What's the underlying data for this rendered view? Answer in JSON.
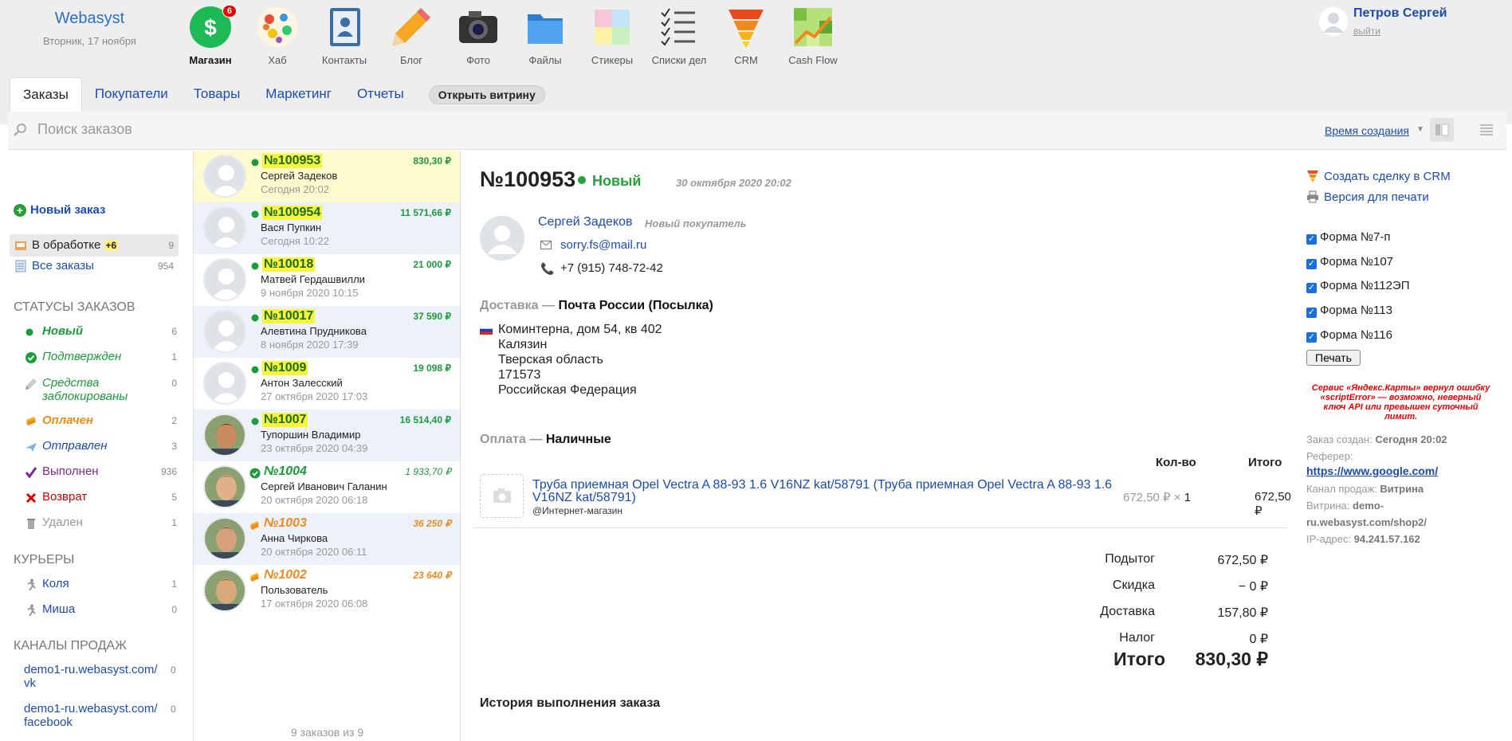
{
  "brand": {
    "name": "Webasyst",
    "date": "Вторник, 17 ноября"
  },
  "apps": [
    {
      "label": "Магазин",
      "icon": "dollar-icon",
      "badge": "6",
      "color": "#1db954"
    },
    {
      "label": "Хаб",
      "icon": "hub-icon",
      "color": "#f0a"
    },
    {
      "label": "Контакты",
      "icon": "contacts-book-icon",
      "color": "#3a6ea5"
    },
    {
      "label": "Блог",
      "icon": "pencil-icon",
      "color": "#f5a623"
    },
    {
      "label": "Фото",
      "icon": "camera-icon",
      "color": "#333"
    },
    {
      "label": "Файлы",
      "icon": "folder-icon",
      "color": "#3b8fd9"
    },
    {
      "label": "Стикеры",
      "icon": "stickers-icon",
      "color": "#f7c6d9"
    },
    {
      "label": "Списки дел",
      "icon": "checklist-icon",
      "color": "#555"
    },
    {
      "label": "CRM",
      "icon": "funnel-icon",
      "color": "#f08a1c"
    },
    {
      "label": "Cash Flow",
      "icon": "cashflow-icon",
      "color": "#7bc043"
    }
  ],
  "user": {
    "name": "Петров Сергей",
    "logout": "выйти"
  },
  "tabs": [
    "Заказы",
    "Покупатели",
    "Товары",
    "Маркетинг",
    "Отчеты"
  ],
  "store_button": "Открыть витрину",
  "search": {
    "placeholder": "Поиск заказов",
    "sort": "Время создания"
  },
  "sidebar": {
    "new_order": "Новый заказ",
    "processing": {
      "label": "В обработке",
      "plus": "+6",
      "count": "9"
    },
    "all": {
      "label": "Все заказы",
      "count": "954"
    },
    "statuses_title": "Статусы заказов",
    "statuses": [
      {
        "label": "Новый",
        "count": "6",
        "color": "#1a9c3a",
        "icon": "green-dot-icon"
      },
      {
        "label": "Подтвержден",
        "count": "1",
        "color": "#1a9c3a",
        "icon": "check-circle-icon"
      },
      {
        "label": "Средства заблокированы",
        "count": "0",
        "color": "#1a9c3a",
        "icon": "pencil-lock-icon"
      },
      {
        "label": "Оплачен",
        "count": "2",
        "color": "#f08a1c",
        "icon": "money-icon"
      },
      {
        "label": "Отправлен",
        "count": "3",
        "color": "#1a4bb5",
        "icon": "plane-icon"
      },
      {
        "label": "Выполнен",
        "count": "936",
        "color": "#7a2a8a",
        "icon": "checkmark-icon"
      },
      {
        "label": "Возврат",
        "count": "5",
        "color": "#d00",
        "icon": "cross-icon"
      },
      {
        "label": "Удален",
        "count": "1",
        "color": "#999",
        "icon": "trash-icon"
      }
    ],
    "couriers_title": "Курьеры",
    "couriers": [
      {
        "label": "Коля",
        "count": "1"
      },
      {
        "label": "Миша",
        "count": "0"
      }
    ],
    "channels_title": "Каналы продаж",
    "channels": [
      {
        "label1": "demo1-ru.webasyst.com/",
        "label2": "vk",
        "count": "0"
      },
      {
        "label1": "demo1-ru.webasyst.com/",
        "label2": "facebook",
        "count": "0"
      }
    ]
  },
  "orders": [
    {
      "num": "№100953",
      "name": "Сергей Задеков",
      "date": "Сегодня 20:02",
      "sum": "830,30 ₽",
      "status": "new",
      "avatar": "default"
    },
    {
      "num": "№100954",
      "name": "Вася Пупкин",
      "date": "Сегодня 10:22",
      "sum": "11 571,66 ₽",
      "status": "new",
      "avatar": "default"
    },
    {
      "num": "№10018",
      "name": "Матвей Гердашвилли",
      "date": "9 ноября 2020 10:15",
      "sum": "21 000 ₽",
      "status": "new",
      "avatar": "default"
    },
    {
      "num": "№10017",
      "name": "Алевтина Прудникова",
      "date": "8 ноября 2020 17:39",
      "sum": "37 590 ₽",
      "status": "new",
      "avatar": "default"
    },
    {
      "num": "№1009",
      "name": "Антон Залесский",
      "date": "27 октября 2020 17:03",
      "sum": "19 098 ₽",
      "status": "new",
      "avatar": "default"
    },
    {
      "num": "№1007",
      "name": "Тупоршин Владимир",
      "date": "23 октября 2020 04:39",
      "sum": "16 514,40 ₽",
      "status": "new",
      "avatar": "photo"
    },
    {
      "num": "№1004",
      "name": "Сергей Иванович Галанин",
      "date": "20 октября 2020 06:18",
      "sum": "1 933,70 ₽",
      "status": "confirmed",
      "avatar": "photo"
    },
    {
      "num": "№1003",
      "name": "Анна Чиркова",
      "date": "20 октября 2020 06:11",
      "sum": "36 250 ₽",
      "status": "paid",
      "avatar": "photo"
    },
    {
      "num": "№1002",
      "name": "Пользователь",
      "date": "17 октября 2020 06:08",
      "sum": "23 640 ₽",
      "status": "paid",
      "avatar": "photo"
    }
  ],
  "orders_footer": "9 заказов из 9",
  "order": {
    "number": "№100953",
    "status": "Новый",
    "date": "30 октября 2020 20:02",
    "customer": "Сергей Задеков",
    "customer_tag": "Новый покупатель",
    "email": "sorry.fs@mail.ru",
    "phone": "+7 (915) 748-72-42",
    "delivery_label": "Доставка —",
    "delivery": "Почта России (Посылка)",
    "address": [
      "Коминтерна, дом 54, кв 402",
      "Калязин",
      "Тверская область",
      "171573",
      "Российская Федерация"
    ],
    "payment_label": "Оплата —",
    "payment": "Наличные",
    "col_qty": "Кол-во",
    "col_total": "Итого",
    "item": {
      "name": "Труба приемная Opel Vectra A 88-93 1.6 V16NZ kat/58791 (Труба приемная Opel Vectra A 88-93 1.6 V16NZ kat/58791)",
      "store": "@Интернет-магазин",
      "price": "672,50 ₽ ×",
      "qty": "1",
      "total": "672,50 ₽"
    },
    "totals": [
      {
        "k": "Подытог",
        "v": "672,50 ₽"
      },
      {
        "k": "Скидка",
        "v": "− 0 ₽"
      },
      {
        "k": "Доставка",
        "v": "157,80 ₽"
      },
      {
        "k": "Налог",
        "v": "0 ₽"
      }
    ],
    "grand_label": "Итого",
    "grand": "830,30 ₽",
    "history": "История выполнения заказа"
  },
  "right": {
    "crm": "Создать сделку в CRM",
    "print_version": "Версия для печати",
    "forms": [
      "Форма №7-п",
      "Форма №107",
      "Форма №112ЭП",
      "Форма №113",
      "Форма №116"
    ],
    "print_button": "Печать",
    "map_error": "Сервис «Яндекс.Карты» вернул ошибку «scriptError» — возможно, неверный ключ API или превышен суточный лимит.",
    "created_label": "Заказ создан:",
    "created": "Сегодня 20:02",
    "referer_label": "Реферер:",
    "referer": "https://www.google.com/",
    "channel_label": "Канал продаж:",
    "channel": "Витрина",
    "storefront_label": "Витрина:",
    "storefront": "demo-ru.webasyst.com/shop2/",
    "ip_label": "IP-адрес:",
    "ip": "94.241.57.162"
  }
}
